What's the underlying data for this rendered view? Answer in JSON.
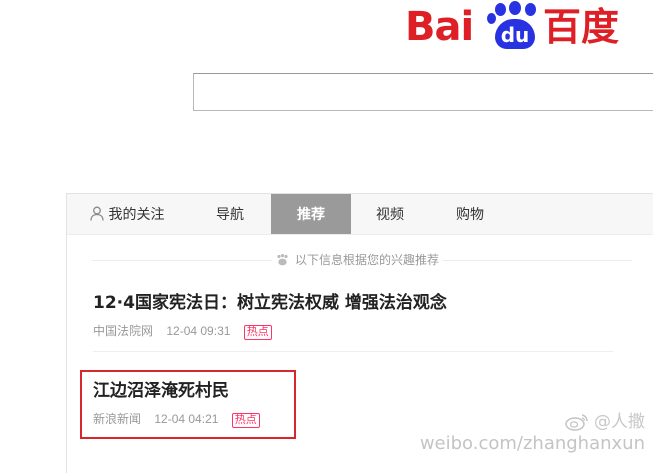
{
  "logo": {
    "latin": "Bai",
    "paw_text": "du",
    "chinese": "百度",
    "red": "#de1f26",
    "blue": "#2932e1"
  },
  "search": {
    "value": "",
    "placeholder": ""
  },
  "tabs": [
    {
      "label": "我的关注",
      "icon": "user-icon",
      "active": false
    },
    {
      "label": "导航",
      "active": false
    },
    {
      "label": "推荐",
      "active": true
    },
    {
      "label": "视频",
      "active": false
    },
    {
      "label": "购物",
      "active": false
    }
  ],
  "notice": {
    "icon": "paw-icon",
    "text": "以下信息根据您的兴趣推荐"
  },
  "news": [
    {
      "title": "12·4国家宪法日：树立宪法权威 增强法治观念",
      "source": "中国法院网",
      "time": "12-04 09:31",
      "badge": "热点"
    },
    {
      "title": "江边沼泽淹死村民",
      "source": "新浪新闻",
      "time": "12-04 04:21",
      "badge": "热点"
    }
  ],
  "highlight_color": "#d9262c",
  "watermark": {
    "handle": "@人撒",
    "url": "weibo.com/zhanghanxun"
  }
}
